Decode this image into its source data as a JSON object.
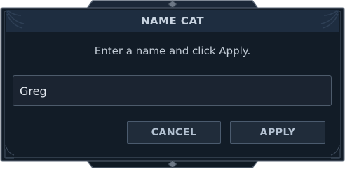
{
  "dialog": {
    "title": "NAME CAT",
    "instruction": "Enter a name and click Apply."
  },
  "name_input": {
    "value": "Greg"
  },
  "buttons": {
    "cancel_label": "CANCEL",
    "apply_label": "APPLY"
  },
  "colors": {
    "panel_background": "#121c27",
    "title_bar": "#1e2d40",
    "frame_border": "#4a5564",
    "text": "#c3ccd6",
    "button_fill": "#202c3a"
  }
}
